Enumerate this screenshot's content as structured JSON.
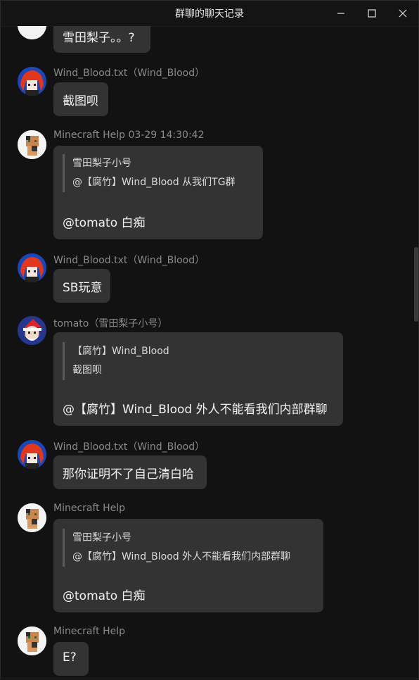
{
  "window": {
    "title": "群聊的聊天记录"
  },
  "messages": [
    {
      "text": "雪田梨子。。?"
    },
    {
      "sender": "Wind_Blood.txt（Wind_Blood）",
      "text": "截图呗"
    },
    {
      "sender": "Minecraft Help 03-29 14:30:42",
      "quote": [
        "雪田梨子小号",
        "@【腐竹】Wind_Blood 从我们TG群"
      ],
      "text": "@tomato 白痴"
    },
    {
      "sender": "Wind_Blood.txt（Wind_Blood）",
      "text": "SB玩意"
    },
    {
      "sender": "tomato（雪田梨子小号）",
      "quote": [
        "【腐竹】Wind_Blood",
        "截图呗"
      ],
      "text": "@【腐竹】Wind_Blood 外人不能看我们内部群聊"
    },
    {
      "sender": "Wind_Blood.txt（Wind_Blood）",
      "text": "那你证明不了自己清白哈"
    },
    {
      "sender": "Minecraft Help",
      "quote": [
        "雪田梨子小号",
        "@【腐竹】Wind_Blood 外人不能看我们内部群聊"
      ],
      "text": "@tomato 白痴"
    },
    {
      "sender": "Minecraft Help",
      "text": "E?"
    }
  ],
  "avatars": {
    "wind": "anime-red-hair-avatar",
    "help": "minecraft-cat-avatar",
    "tomato": "santa-avatar"
  }
}
